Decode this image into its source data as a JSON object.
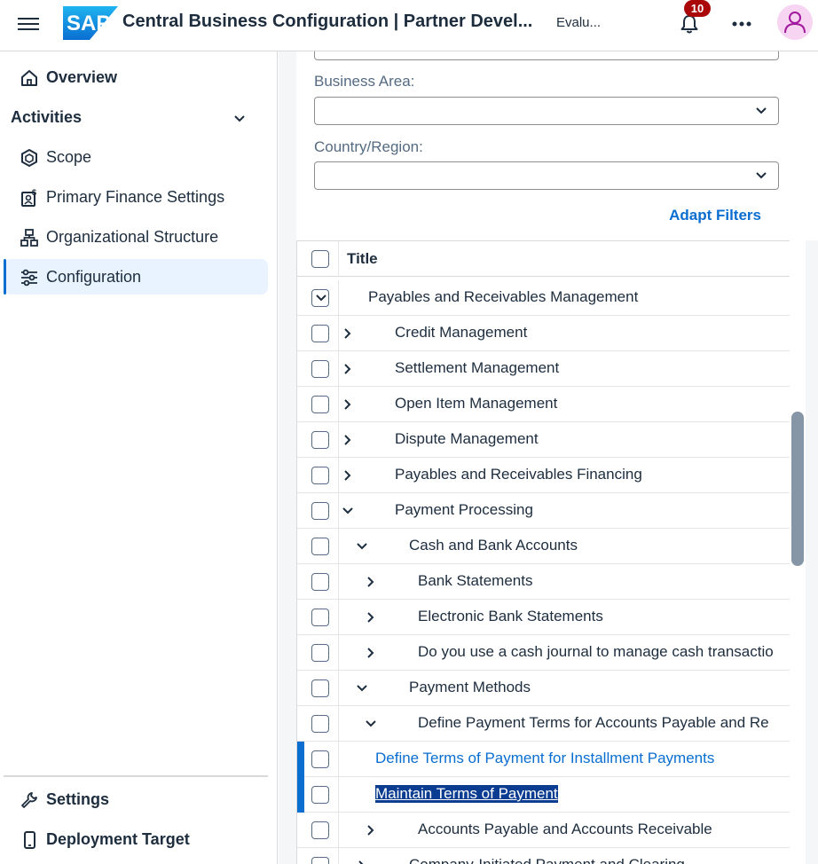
{
  "shell": {
    "title": "Central Business Configuration | Partner Devel...",
    "system": "Evalu...",
    "notifications_count": "10",
    "logo_text": "SAP"
  },
  "sidebar": {
    "overview": "Overview",
    "activities_group": "Activities",
    "items": [
      {
        "label": "Scope",
        "icon": "scope-icon"
      },
      {
        "label": "Primary Finance Settings",
        "icon": "finance-settings-icon"
      },
      {
        "label": "Organizational Structure",
        "icon": "org-structure-icon"
      },
      {
        "label": "Configuration",
        "icon": "configuration-icon",
        "active": true
      }
    ],
    "footer": [
      {
        "label": "Settings",
        "icon": "wrench-icon"
      },
      {
        "label": "Deployment Target",
        "icon": "device-icon"
      }
    ]
  },
  "filters": {
    "business_area_label": "Business Area:",
    "business_area_value": "",
    "country_label": "Country/Region:",
    "country_value": "",
    "adapt_filters": "Adapt Filters"
  },
  "table": {
    "column_title": "Title",
    "rows": [
      {
        "text": "Payables and Receivables Management",
        "expand": "expanded",
        "level": 0
      },
      {
        "text": "Credit Management",
        "expand": "collapsed",
        "level": 1
      },
      {
        "text": "Settlement Management",
        "expand": "collapsed",
        "level": 1
      },
      {
        "text": "Open Item Management",
        "expand": "collapsed",
        "level": 1
      },
      {
        "text": "Dispute Management",
        "expand": "collapsed",
        "level": 1
      },
      {
        "text": "Payables and Receivables Financing",
        "expand": "collapsed",
        "level": 1
      },
      {
        "text": "Payment Processing",
        "expand": "expanded",
        "level": 1
      },
      {
        "text": "Cash and Bank Accounts",
        "expand": "expanded",
        "level": 2
      },
      {
        "text": "Bank Statements",
        "expand": "collapsed",
        "level": 3
      },
      {
        "text": "Electronic Bank Statements",
        "expand": "collapsed",
        "level": 3
      },
      {
        "text": "Do you use a cash journal to manage cash transactio",
        "expand": "collapsed",
        "level": 3
      },
      {
        "text": "Payment Methods",
        "expand": "expanded",
        "level": 2
      },
      {
        "text": "Define Payment Terms for Accounts Payable and Re",
        "expand": "expanded",
        "level": 3
      },
      {
        "text": "Define Terms of Payment for Installment Payments",
        "expand": "none",
        "level": 4,
        "style": "link"
      },
      {
        "text": "Maintain Terms of Payment",
        "expand": "none",
        "level": 4,
        "style": "selected"
      },
      {
        "text": "Accounts Payable and Accounts Receivable",
        "expand": "collapsed",
        "level": 3
      },
      {
        "text": "Company-Initiated Payment and Clearing",
        "expand": "collapsed",
        "level": 2
      }
    ]
  },
  "colors": {
    "brand_blue": "#0a6ed1",
    "badge_red": "#aa0808",
    "avatar_bg": "#f7d4f2",
    "selected_bg": "#0a3d91"
  }
}
